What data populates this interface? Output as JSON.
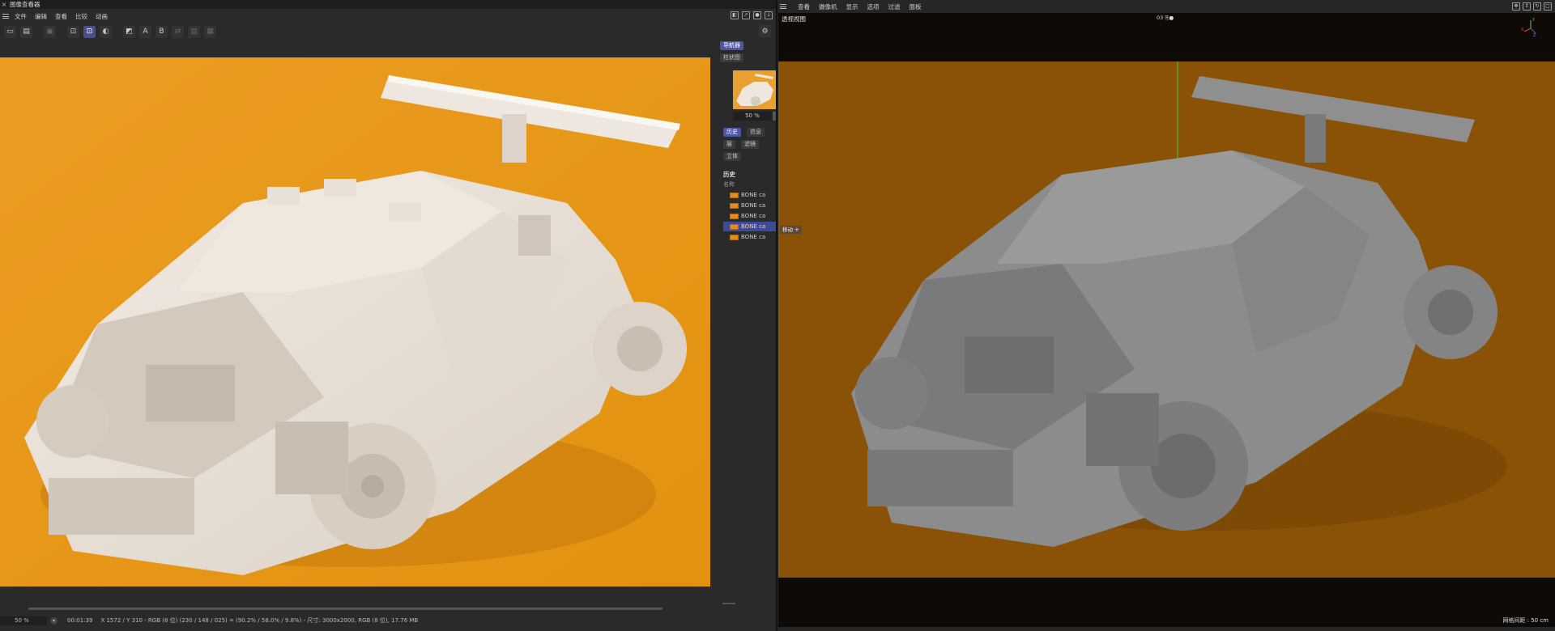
{
  "left_window": {
    "title": "图像查看器",
    "close_glyph": "×",
    "menu": [
      "文件",
      "编辑",
      "查看",
      "比较",
      "动画"
    ],
    "toolbar": {
      "compare_a": "A",
      "compare_b": "B"
    },
    "side_panel": {
      "tabs_top": [
        "导航器",
        "柱状图"
      ],
      "zoom_value": "50 %",
      "tabs_mid": [
        "历史",
        "信息",
        "层",
        "滤镜",
        "立体"
      ],
      "history_heading": "历史",
      "column_name": "名称",
      "history_items": [
        {
          "label": "BONE ca",
          "active": false
        },
        {
          "label": "BONE ca",
          "active": false
        },
        {
          "label": "BONE ca",
          "active": false
        },
        {
          "label": "BONE ca",
          "active": true
        },
        {
          "label": "BONE ca",
          "active": false
        }
      ]
    },
    "status": {
      "zoom": "50 %",
      "time": "00:01:39",
      "info": "X 1572 / Y 310 - RGB (8 位) (230 / 148 / 025) = (90.2% / 58.0% / 9.8%) - 尺寸: 3000x2000, RGB (8 位), 17.76 MB"
    },
    "canvas_bg": "#e99a1d"
  },
  "right_window": {
    "menu": [
      "查看",
      "摄像机",
      "显示",
      "选项",
      "过滤",
      "面板"
    ],
    "viewport_label": "透视视图",
    "center_marker": "03 ⎘●",
    "move_tag": "移动 ✛",
    "grid_info": "网格间距 : 50 cm",
    "gizmo_labels": {
      "x": "X",
      "y": "Y",
      "z": "Z"
    }
  },
  "colors": {
    "accent": "#4d55a8",
    "render_orange": "#e99a1d",
    "viewport_orange": "#8a5206"
  }
}
